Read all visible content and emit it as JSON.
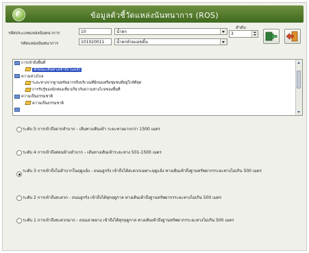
{
  "window": {
    "title": "ข้อมูลตัวชี้วัดแหล่งนันทนาการ (ROS)"
  },
  "form": {
    "code_label": "รหัสประเภทแหล่งนันทนาการ",
    "code_value": "10",
    "type_value": "น้ำตก",
    "place_label": "รหัสแหล่งนันทนาการ",
    "place_code": "101020011",
    "place_name": "น้ำตกห้วยแม่ขมิ้น",
    "order_label": "ลำดับ",
    "order_value": "3"
  },
  "toolbar": {
    "save_icon": "save-arrow-icon",
    "exit_icon": "exit-door-icon"
  },
  "tree": {
    "nodes": [
      {
        "label": "การเข้าถึงพื้นที่",
        "level": 0,
        "kind": "folder"
      },
      {
        "label": "ลักษณะเส้นทางเข้าถึง (unit)",
        "level": 1,
        "kind": "leaf",
        "selected": true
      },
      {
        "label": "ความห่างไกล",
        "level": 0,
        "kind": "folder"
      },
      {
        "label": "ระยะทางจากฐานทรัพยากรถึงบริเวณที่มีถนนหรือชุมชนที่อยู่ใกล้ที่สุด",
        "level": 1,
        "kind": "leaf"
      },
      {
        "label": "การรับรู้ของนักท่องเที่ยวเกี่ยวกับความห่างไกลของพื้นที่",
        "level": 1,
        "kind": "leaf"
      },
      {
        "label": "ความเป็นธรรมชาติ",
        "level": 0,
        "kind": "folder"
      },
      {
        "label": "ความเป็นธรรมชาติ",
        "level": 1,
        "kind": "leaf"
      },
      {
        "label": "",
        "level": 0,
        "kind": "folder"
      }
    ]
  },
  "options": [
    {
      "text": "ระดับ 5 การเข้าถึงยากลำบาก - เส้นทางเดินเท้า ระยะทางมากกว่า 1500 เมตร",
      "selected": false
    },
    {
      "text": "ระดับ 4 การเข้าถึงค่อนข้างลำบาก - เส้นทางเดินเท้าระยะทาง 501-1500 เมตร",
      "selected": false
    },
    {
      "text": "ระดับ 3 การเข้าถึงไม่ลำบากในฤดูแล้ง - ถนนลูกรัง เข้าถึงได้สะดวกเฉพาะฤดูแล้ง ทางเดินเท้าถึงฐานทรัพยากรระยะทางไม่เกิน 500 เมตร",
      "selected": true
    },
    {
      "text": "ระดับ 2 การเข้าถึงสะดวก - ถนนลูกรัง เข้าถึงได้ทุกฤดูกาล ทางเดินเท้าถึงฐานทรัพยากรระยะทางไม่เกิน 500 เมตร",
      "selected": false
    },
    {
      "text": "ระดับ 1 การเข้าถึงสะดวกมาก - ถนนลาดยาง เข้าถึงได้ทุกฤดูกาล ทางเดินเท้าถึงฐานทรัพยากรระยะทางไม่เกิน 500 เมตร",
      "selected": false
    }
  ],
  "colors": {
    "title_bar": "#4f7a2a",
    "selection": "#2a4fbf",
    "background": "#eef0e9"
  }
}
